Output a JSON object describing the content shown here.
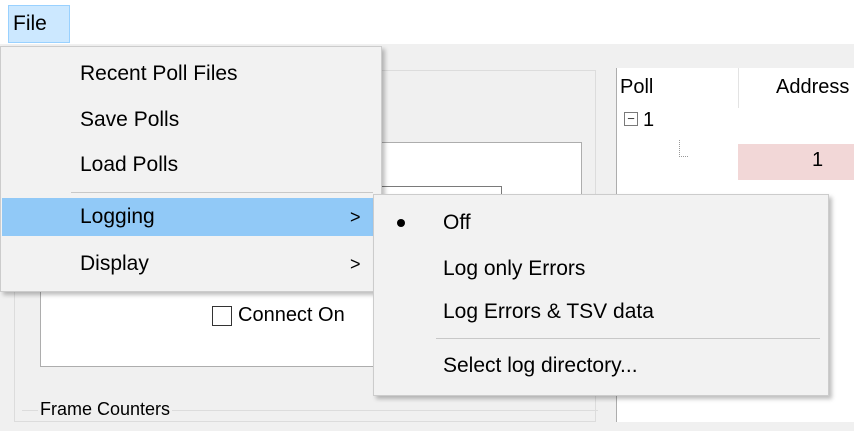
{
  "menubar": {
    "file_label": "File"
  },
  "file_menu": {
    "items": [
      {
        "label": "Recent Poll Files",
        "has_submenu": false
      },
      {
        "label": "Save Polls",
        "has_submenu": false
      },
      {
        "label": "Load Polls",
        "has_submenu": false
      },
      {
        "label": "Logging",
        "has_submenu": true,
        "highlighted": true
      },
      {
        "label": "Display",
        "has_submenu": true
      }
    ],
    "submenu_arrow": ">"
  },
  "logging_submenu": {
    "items": [
      {
        "label": "Off",
        "selected": true
      },
      {
        "label": "Log only Errors",
        "selected": false
      },
      {
        "label": "Log Errors & TSV data",
        "selected": false
      },
      {
        "label": "Select log directory...",
        "selected": false
      }
    ]
  },
  "background": {
    "connect_label": "Connect On",
    "frame_counters_label": "Frame Counters"
  },
  "poll_tree": {
    "columns": [
      "Poll",
      "Address"
    ],
    "expander": "⊟",
    "node_label": "1",
    "child_address": "1"
  },
  "colors": {
    "menu_highlight": "#91c9f7",
    "file_menu_active": "#cce8ff",
    "address_cell": "#f2d7d7"
  }
}
